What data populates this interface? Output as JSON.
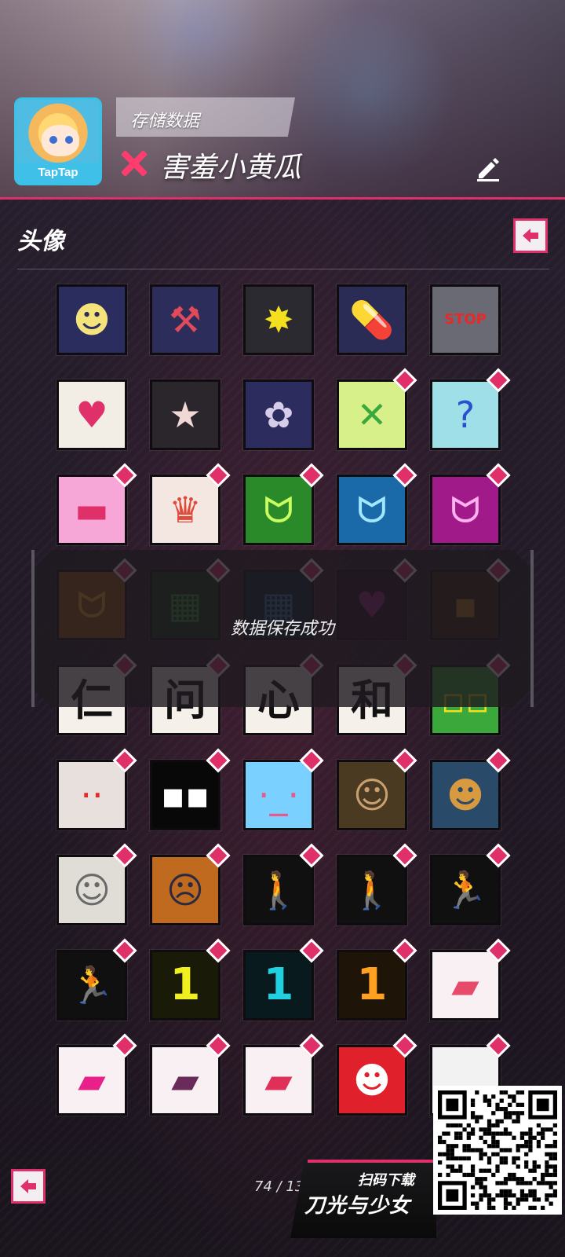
{
  "header": {
    "app_badge": "TapTap",
    "save_label": "存储数据",
    "username": "害羞小黄瓜"
  },
  "section": {
    "title": "头像"
  },
  "toast": {
    "message": "数据保存成功"
  },
  "pager": {
    "text": "74 / 13"
  },
  "promo": {
    "line1": "扫码下载",
    "line2": "刀光与少女"
  },
  "colors": {
    "accent": "#e0306a",
    "background": "#1d1620"
  },
  "avatars": [
    {
      "bg": "#2a2d5e",
      "fg": "#f4e27a",
      "icon": "visor-face-icon",
      "glyph": "☻",
      "badge": false
    },
    {
      "bg": "#2c2d5a",
      "fg": "#e04a5a",
      "icon": "hammer-icon",
      "glyph": "⚒",
      "badge": false
    },
    {
      "bg": "#2a2a30",
      "fg": "#f5e020",
      "icon": "explosion-icon",
      "glyph": "✸",
      "badge": false
    },
    {
      "bg": "#2a2c55",
      "fg": "#3aa4ff",
      "icon": "capsule-icon",
      "glyph": "💊",
      "badge": false
    },
    {
      "bg": "#6a6a74",
      "fg": "#e62a2a",
      "icon": "stop-sign-icon",
      "glyph": "STOP",
      "badge": false
    },
    {
      "bg": "#f2eee6",
      "fg": "#e0306a",
      "icon": "broken-heart-icon",
      "glyph": "♥",
      "badge": false
    },
    {
      "bg": "#2b252c",
      "fg": "#f0d9d4",
      "icon": "star-icon",
      "glyph": "★",
      "badge": false
    },
    {
      "bg": "#2c2d5e",
      "fg": "#d6cdea",
      "icon": "flower-crest-icon",
      "glyph": "✿",
      "badge": false
    },
    {
      "bg": "#d8f08a",
      "fg": "#3aa83a",
      "icon": "cat-yellow-icon",
      "glyph": "✕",
      "badge": true
    },
    {
      "bg": "#9fe0e8",
      "fg": "#2a4fd0",
      "icon": "cat-cyan-icon",
      "glyph": "?",
      "badge": true
    },
    {
      "bg": "#f7a6d8",
      "fg": "#e0306a",
      "icon": "cat-pink-icon",
      "glyph": "▬",
      "badge": true
    },
    {
      "bg": "#f4e6e0",
      "fg": "#e04a3a",
      "icon": "cat-white-icon",
      "glyph": "♛",
      "badge": true
    },
    {
      "bg": "#2a8a2a",
      "fg": "#c8ff60",
      "icon": "grin-green-icon",
      "glyph": "ᗢ",
      "badge": true
    },
    {
      "bg": "#1a6aaa",
      "fg": "#a0e8ff",
      "icon": "grin-blue-icon",
      "glyph": "ᗢ",
      "badge": true
    },
    {
      "bg": "#a01a8a",
      "fg": "#ffb0f0",
      "icon": "grin-magenta-icon",
      "glyph": "ᗢ",
      "badge": true
    },
    {
      "bg": "#a05a10",
      "fg": "#ffb030",
      "icon": "grin-orange-icon",
      "glyph": "ᗢ",
      "badge": true
    },
    {
      "bg": "#1a3a1a",
      "fg": "#3a9a3a",
      "icon": "pixel-face-green-icon",
      "glyph": "▦",
      "badge": true
    },
    {
      "bg": "#10253a",
      "fg": "#3a7ab0",
      "icon": "pixel-face-blue-icon",
      "glyph": "▦",
      "badge": true
    },
    {
      "bg": "#2a1028",
      "fg": "#9a2a8a",
      "icon": "pixel-heart-icon",
      "glyph": "♥",
      "badge": true
    },
    {
      "bg": "#3a2210",
      "fg": "#c08020",
      "icon": "pixel-dark-icon",
      "glyph": "▪",
      "badge": true
    },
    {
      "bg": "#f6f0ea",
      "fg": "#111111",
      "icon": "kanji-ren-icon",
      "glyph": "仁",
      "kanji": true,
      "badge": true
    },
    {
      "bg": "#f6f0ea",
      "fg": "#111111",
      "icon": "kanji-wen-icon",
      "glyph": "问",
      "kanji": true,
      "badge": true
    },
    {
      "bg": "#f6f0ea",
      "fg": "#111111",
      "icon": "kanji-xin-icon",
      "glyph": "心",
      "kanji": true,
      "badge": true
    },
    {
      "bg": "#f6f0ea",
      "fg": "#111111",
      "icon": "kanji-he-icon",
      "glyph": "和",
      "kanji": true,
      "badge": true
    },
    {
      "bg": "#3aa83a",
      "fg": "#f0e020",
      "icon": "green-block-face-icon",
      "glyph": "▫▫",
      "badge": true
    },
    {
      "bg": "#e8e0dc",
      "fg": "#e62a2a",
      "icon": "beige-block-face-icon",
      "glyph": "··",
      "badge": true
    },
    {
      "bg": "#080808",
      "fg": "#ffffff",
      "icon": "black-block-face-icon",
      "glyph": "▪▪",
      "badge": true
    },
    {
      "bg": "#7ad0ff",
      "fg": "#e85a8a",
      "icon": "blue-block-face-icon",
      "glyph": "·_·",
      "badge": true
    },
    {
      "bg": "#4a3a22",
      "fg": "#c8a070",
      "icon": "mona-lisa-icon",
      "glyph": "☺",
      "badge": true
    },
    {
      "bg": "#2a4a6a",
      "fg": "#d89a40",
      "icon": "van-gogh-icon",
      "glyph": "☻",
      "badge": true
    },
    {
      "bg": "#e0dcd6",
      "fg": "#6a6a6a",
      "icon": "david-statue-icon",
      "glyph": "☺",
      "badge": true
    },
    {
      "bg": "#c06a20",
      "fg": "#2a2a40",
      "icon": "the-scream-icon",
      "glyph": "☹",
      "badge": true
    },
    {
      "bg": "#101010",
      "fg": "#6af02a",
      "icon": "walk-signal-green-icon",
      "glyph": "🚶",
      "badge": true
    },
    {
      "bg": "#101010",
      "fg": "#ff2a2a",
      "icon": "walk-signal-red-icon",
      "glyph": "🚶",
      "badge": true
    },
    {
      "bg": "#101010",
      "fg": "#ffd020",
      "icon": "run-signal-yellow-icon",
      "glyph": "🏃",
      "badge": true
    },
    {
      "bg": "#101010",
      "fg": "#20b8ff",
      "icon": "run-signal-blue-icon",
      "glyph": "🏃",
      "badge": true
    },
    {
      "bg": "#1a1a08",
      "fg": "#f0f020",
      "icon": "number-one-yellow-icon",
      "glyph": "1",
      "badge": true
    },
    {
      "bg": "#081a1e",
      "fg": "#20d0e0",
      "icon": "number-one-cyan-icon",
      "glyph": "1",
      "badge": true
    },
    {
      "bg": "#1e1408",
      "fg": "#ffa020",
      "icon": "number-one-orange-icon",
      "glyph": "1",
      "badge": true
    },
    {
      "bg": "#f8f0f2",
      "fg": "#e84a6a",
      "icon": "lipstick-coral-icon",
      "glyph": "▰",
      "badge": true
    },
    {
      "bg": "#f8f0f2",
      "fg": "#e8208a",
      "icon": "lipstick-pink-icon",
      "glyph": "▰",
      "badge": true
    },
    {
      "bg": "#f8f0f2",
      "fg": "#6a2a5a",
      "icon": "lipstick-plum-icon",
      "glyph": "▰",
      "badge": true
    },
    {
      "bg": "#f8f0f2",
      "fg": "#e0305a",
      "icon": "lipstick-red-icon",
      "glyph": "▰",
      "badge": true
    },
    {
      "bg": "#e0202a",
      "fg": "#ffffff",
      "icon": "clown-face-icon",
      "glyph": "☻",
      "badge": true
    },
    {
      "bg": "#f2f2f2",
      "fg": "#222222",
      "icon": "hidden-avatar-icon",
      "glyph": "",
      "badge": true
    }
  ]
}
